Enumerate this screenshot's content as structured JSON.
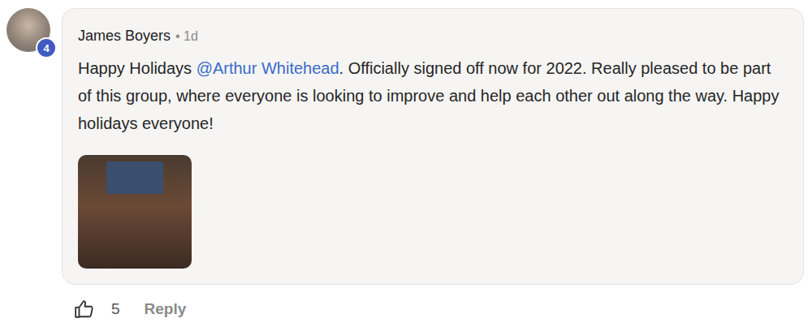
{
  "comment": {
    "author": "James Boyers",
    "separator": "•",
    "time": "1d",
    "level_badge": "4",
    "body_before": "Happy Holidays ",
    "mention": "@Arthur Whitehead",
    "body_after": ". Officially signed off now for 2022. Really pleased to be part of this group, where everyone is looking to improve and help each other out along the way. Happy holidays everyone!",
    "likes": "5",
    "reply_label": "Reply"
  }
}
